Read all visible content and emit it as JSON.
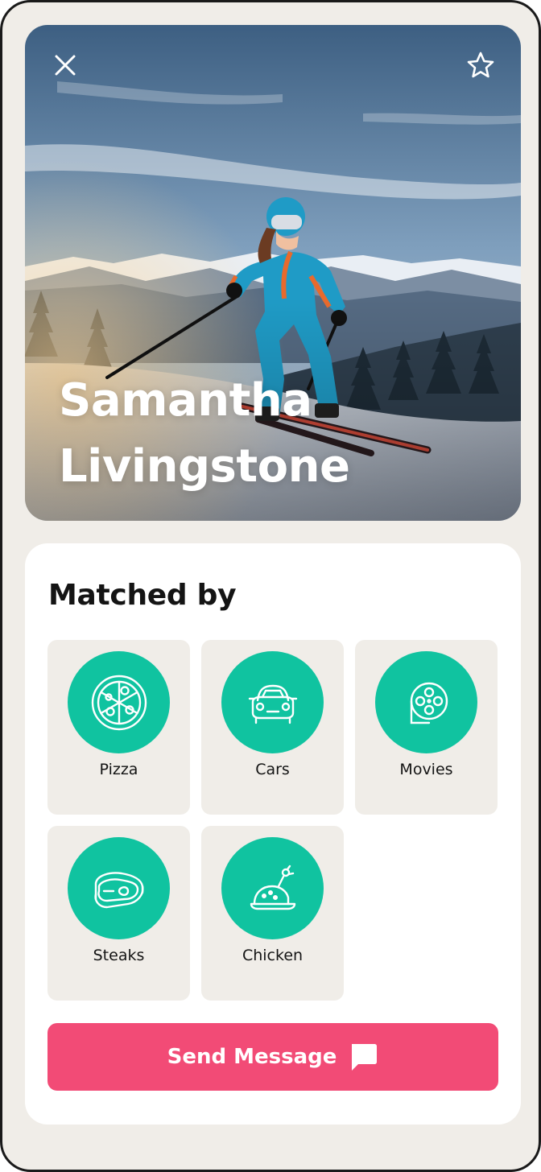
{
  "profile": {
    "first_name": "Samantha",
    "last_name": "Livingstone"
  },
  "hero": {
    "close_icon": "close-icon",
    "favorite_icon": "star-outline-icon"
  },
  "matched": {
    "title": "Matched by",
    "items": [
      {
        "label": "Pizza",
        "icon": "pizza-icon"
      },
      {
        "label": "Cars",
        "icon": "car-icon"
      },
      {
        "label": "Movies",
        "icon": "film-reel-icon"
      },
      {
        "label": "Steaks",
        "icon": "steak-icon"
      },
      {
        "label": "Chicken",
        "icon": "roast-chicken-icon"
      }
    ]
  },
  "actions": {
    "send_message_label": "Send Message",
    "send_message_icon": "chat-bubble-icon"
  },
  "colors": {
    "accent_green": "#10c3a0",
    "accent_pink": "#f24b76",
    "tile_bg": "#f0ede8",
    "text_dark": "#141414"
  }
}
